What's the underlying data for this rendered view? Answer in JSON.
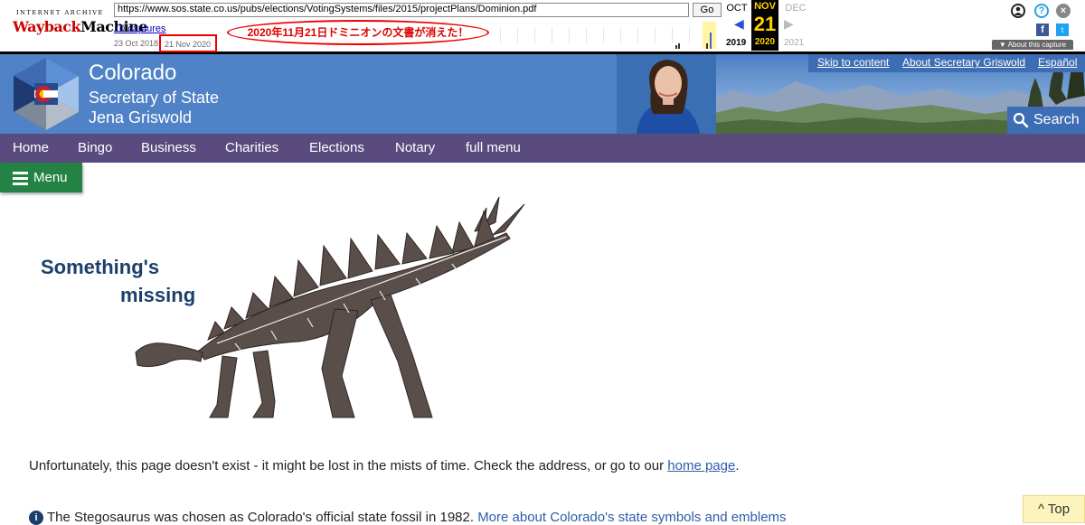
{
  "wayback": {
    "logo_top": "INTERNET ARCHIVE",
    "logo_word1": "Wayback",
    "logo_word2": "Machine",
    "url": "https://www.sos.state.co.us/pubs/elections/VotingSystems/files/2015/projectPlans/Dominion.pdf",
    "go_label": "Go",
    "captures_label": "10 captures",
    "first_capture": "23 Oct 2018",
    "last_capture": "21 Nov 2020",
    "annotation": "2020年11月21日ドミニオンの文書が消えた！",
    "calendar": {
      "prev_month": "OCT",
      "cur_month": "NOV",
      "next_month": "DEC",
      "cur_day": "21",
      "prev_year": "2019",
      "cur_year": "2020",
      "next_year": "2021"
    },
    "icons": {
      "user": "user-icon",
      "help": "help-icon",
      "close": "close-icon",
      "facebook": "facebook-icon",
      "twitter": "twitter-icon"
    },
    "help_glyph": "?",
    "close_glyph": "×",
    "fb_glyph": "f",
    "tw_glyph": "t",
    "about_capture": "▼ About this capture"
  },
  "header": {
    "title1": "Colorado",
    "title2": "Secretary of State",
    "title3": "Jena Griswold",
    "links": {
      "skip": "Skip to content",
      "about": "About Secretary Griswold",
      "espanol": "Español"
    },
    "search_label": "Search"
  },
  "nav": {
    "items": [
      "Home",
      "Bingo",
      "Business",
      "Charities",
      "Elections",
      "Notary",
      "full menu"
    ]
  },
  "menu_label": "Menu",
  "content": {
    "heading_line1": "Something's",
    "heading_line2": "missing",
    "message_before": "Unfortunately, this page doesn't exist - it might be lost in the mists of time. Check the address, or go to our ",
    "message_link": "home page",
    "message_after": ".",
    "info_glyph": "i",
    "fact_text": "The Stegosaurus was chosen as Colorado's official state fossil in 1982. ",
    "fact_link": "More about Colorado's state symbols and emblems"
  },
  "top_button": "^ Top",
  "colors": {
    "header_blue": "#4f82c6",
    "nav_purple": "#5a4b7e",
    "menu_green": "#238244",
    "heading_navy": "#1b3f6b",
    "link_blue": "#2e5da8",
    "annotation_red": "#e00000"
  }
}
